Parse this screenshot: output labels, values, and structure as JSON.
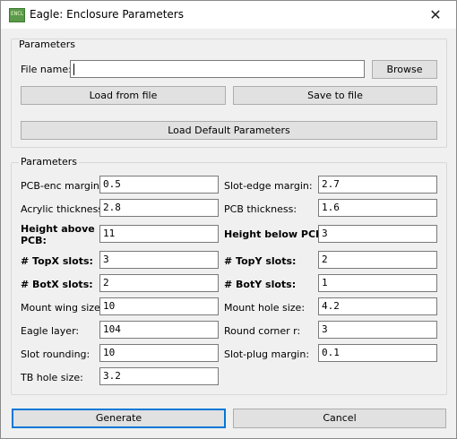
{
  "window": {
    "title": "Eagle: Enclosure Parameters",
    "icon": "enclosure-app-icon",
    "icon_text": "ENCL"
  },
  "file_group": {
    "title": "Parameters",
    "file_label": "File name:",
    "file_value": "",
    "browse_label": "Browse",
    "load_label": "Load from file",
    "save_label": "Save to file",
    "defaults_label": "Load Default Parameters"
  },
  "params": {
    "title": "Parameters",
    "pcb_enc_margin": {
      "label": "PCB-enc margin:",
      "value": "0.5"
    },
    "slot_edge_margin": {
      "label": "Slot-edge margin:",
      "value": "2.7"
    },
    "acrylic_thickness": {
      "label": "Acrylic thickness:",
      "value": "2.8"
    },
    "pcb_thickness": {
      "label": "PCB thickness:",
      "value": "1.6"
    },
    "height_above_pcb": {
      "label_line1": "Height above",
      "label_line2": "PCB:",
      "value": "11"
    },
    "height_below_pcb": {
      "label": "Height below PCB:",
      "value": "3"
    },
    "topx_slots": {
      "label": "# TopX slots:",
      "value": "3"
    },
    "topy_slots": {
      "label": "# TopY slots:",
      "value": "2"
    },
    "botx_slots": {
      "label": "# BotX slots:",
      "value": "2"
    },
    "boty_slots": {
      "label": "# BotY slots:",
      "value": "1"
    },
    "mount_wing_size": {
      "label": "Mount wing size:",
      "value": "10"
    },
    "mount_hole_size": {
      "label": "Mount hole size:",
      "value": "4.2"
    },
    "eagle_layer": {
      "label": "Eagle layer:",
      "value": "104"
    },
    "round_corner_r": {
      "label": "Round corner r:",
      "value": "3"
    },
    "slot_rounding": {
      "label": "Slot rounding:",
      "value": "10"
    },
    "slot_plug_margin": {
      "label": "Slot-plug margin:",
      "value": "0.1"
    },
    "tb_hole_size": {
      "label": "TB hole size:",
      "value": "3.2"
    }
  },
  "footer": {
    "generate_label": "Generate",
    "cancel_label": "Cancel"
  },
  "colors": {
    "primary_border": "#0078d7",
    "button_bg": "#e1e1e1",
    "window_bg": "#f0f0f0"
  }
}
